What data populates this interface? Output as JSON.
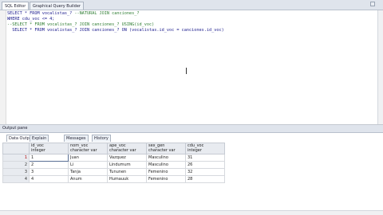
{
  "editor": {
    "tabs": [
      {
        "label": "SQL Editor",
        "active": true
      },
      {
        "label": "Graphical Query Builder",
        "active": false
      }
    ],
    "lines": [
      {
        "text": "SELECT * FROM vocalistas_? ",
        "comment": "--NATURAL JOIN canciones_?"
      },
      {
        "text": "WHERE cdu_voc <= 4;",
        "comment": ""
      },
      {
        "text": "",
        "comment": "--SELECT * FROM vocalistas_? JOIN canciones_? USING(id_voc)"
      },
      {
        "text": "  SELECT * FROM vocalistas_? JOIN canciones_? ON (vocalistas.id_voc = canciones.id_voc)",
        "comment": ""
      }
    ]
  },
  "output": {
    "title": "Output pane",
    "tabs": [
      {
        "label": "Data Output",
        "active": true
      },
      {
        "label": "Explain",
        "active": false
      },
      {
        "label": "Messages",
        "active": false
      },
      {
        "label": "History",
        "active": false
      }
    ],
    "columns": [
      {
        "name": "id_voc",
        "type": "integer"
      },
      {
        "name": "nom_voc",
        "type": "character var"
      },
      {
        "name": "ape_voc",
        "type": "character var"
      },
      {
        "name": "sex_gen",
        "type": "character var"
      },
      {
        "name": "cdu_voc",
        "type": "integer"
      }
    ],
    "rows": [
      {
        "num": "1",
        "cells": [
          "1",
          "Juan",
          "Vazquez",
          "Masculino",
          "31"
        ]
      },
      {
        "num": "2",
        "cells": [
          "2",
          "Li",
          "Lindumum",
          "Masculino",
          "26"
        ]
      },
      {
        "num": "3",
        "cells": [
          "3",
          "Tanja",
          "Tununen",
          "Femenino",
          "32"
        ]
      },
      {
        "num": "4",
        "cells": [
          "4",
          "Anum",
          "Humauuk",
          "Femenino",
          "28"
        ]
      }
    ]
  }
}
